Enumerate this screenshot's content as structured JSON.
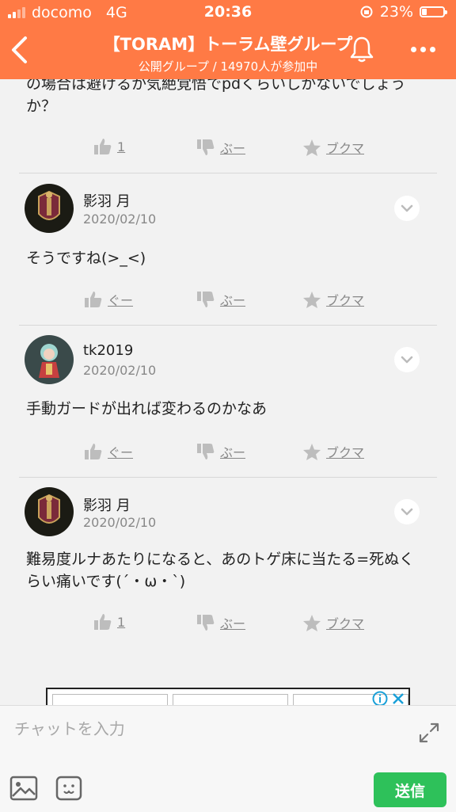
{
  "status_bar": {
    "carrier": "docomo",
    "network": "4G",
    "time": "20:36",
    "battery": "23%"
  },
  "header": {
    "title": "【TORAM】トーラム壁グループ",
    "subtitle": "公開グループ / 14970人が参加中",
    "accent_color": "#ff7a45"
  },
  "posts": [
    {
      "text": "の場合は避けるか気絶覚悟でpdくらいしかないでしょうか？",
      "like": "1",
      "dislike": "ぶー",
      "bookmark": "ブクマ"
    },
    {
      "author": "影羽 月",
      "date": "2020/02/10",
      "text": "そうですね(>_<)",
      "like": "ぐー",
      "dislike": "ぶー",
      "bookmark": "ブクマ"
    },
    {
      "author": "tk2019",
      "date": "2020/02/10",
      "text": "手動ガードが出れば変わるのかなあ",
      "like": "ぐー",
      "dislike": "ぶー",
      "bookmark": "ブクマ"
    },
    {
      "author": "影羽 月",
      "date": "2020/02/10",
      "text": "難易度ルナあたりになると、あのトゲ床に当たる=死ぬくらい痛いです(´・ω・`)",
      "like": "1",
      "dislike": "ぶー",
      "bookmark": "ブクマ"
    }
  ],
  "composer": {
    "placeholder": "チャットを入力",
    "send_label": "送信",
    "send_color": "#2ec15a"
  }
}
